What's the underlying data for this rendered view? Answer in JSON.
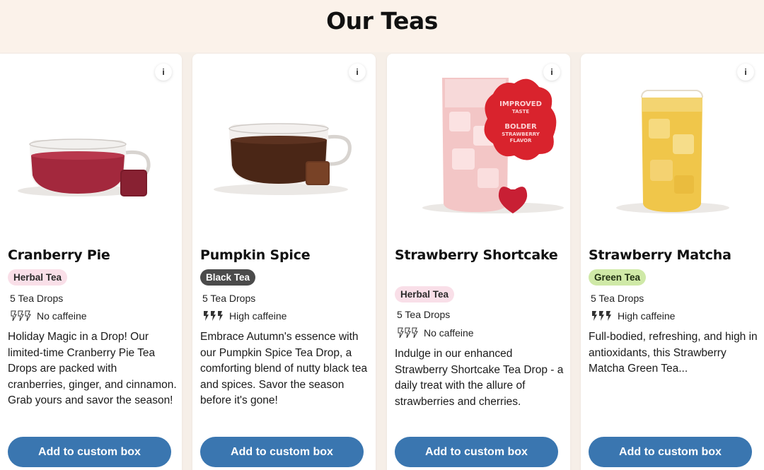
{
  "page": {
    "title": "Our Teas"
  },
  "cards": [
    {
      "name": "Cranberry Pie",
      "type": "Herbal Tea",
      "drops": "5 Tea Drops",
      "caffeine": "No caffeine",
      "description": "Holiday Magic in a Drop! Our limited-time Cranberry Pie Tea Drops are packed with cranberries, ginger, and cinnamon. Grab yours and savor the season!",
      "button": "Add to custom box",
      "info": "i"
    },
    {
      "name": "Pumpkin Spice",
      "type": "Black Tea",
      "drops": "5 Tea Drops",
      "caffeine": "High caffeine",
      "description": "Embrace Autumn's essence with our Pumpkin Spice Tea Drop, a comforting blend of nutty black tea and spices. Savor the season before it's gone!",
      "button": "Add to custom box",
      "info": "i"
    },
    {
      "name": "Strawberry Shortcake",
      "type": "Herbal Tea",
      "drops": "5 Tea Drops",
      "caffeine": "No caffeine",
      "description": "Indulge in our enhanced Strawberry Shortcake Tea Drop - a daily treat with the allure of strawberries and cherries.",
      "button": "Add to custom box",
      "info": "i",
      "sticker": {
        "line1": "IMPROVED",
        "line2": "TASTE",
        "line3": "BOLDER",
        "line4": "STRAWBERRY",
        "line5": "FLAVOR"
      }
    },
    {
      "name": "Strawberry Matcha",
      "type": "Green Tea",
      "drops": "5 Tea Drops",
      "caffeine": "High caffeine",
      "description": "Full-bodied, refreshing, and high in antioxidants, this Strawberry Matcha Green Tea...",
      "button": "Add to custom box",
      "info": "i"
    }
  ],
  "colors": {
    "button": "#3a76b0",
    "herbal_badge": "#f9dfe8",
    "black_badge": "#4b4b4b",
    "green_badge": "#cfe9a7",
    "background": "#f6efe8"
  }
}
